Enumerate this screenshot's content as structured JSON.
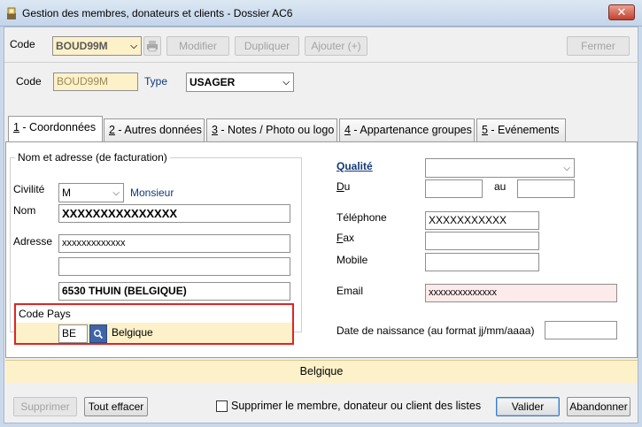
{
  "window": {
    "title": "Gestion des membres, donateurs et clients - Dossier AC6",
    "close_glyph": "✕"
  },
  "toolbar": {
    "code_label": "Code",
    "code_value": "BOUD99M",
    "modifier": "Modifier",
    "dupliquer": "Dupliquer",
    "ajouter": "Ajouter (+)",
    "fermer": "Fermer"
  },
  "header": {
    "code_label": "Code",
    "code_value": "BOUD99M",
    "type_label": "Type",
    "type_value": "USAGER"
  },
  "tabs": [
    {
      "num": "1",
      "label": " - Coordonnées"
    },
    {
      "num": "2",
      "label": " - Autres données"
    },
    {
      "num": "3",
      "label": " - Notes / Photo ou logo"
    },
    {
      "num": "4",
      "label": " - Appartenance groupes"
    },
    {
      "num": "5",
      "label": " - Evénements"
    }
  ],
  "address": {
    "group_title": "Nom et adresse (de facturation)",
    "civilite_label": "Civilité",
    "civilite_value": "M",
    "civilite_text": "Monsieur",
    "nom_label": "Nom",
    "nom_value": "XXXXXXXXXXXXXXX",
    "adresse_label": "Adresse",
    "adresse_line1": "xxxxxxxxxxxxx",
    "adresse_line2": "",
    "adresse_line3": "6530 THUIN (BELGIQUE)",
    "code_pays_label": "Code Pays",
    "code_pays_value": "BE",
    "pays_name": "Belgique"
  },
  "right": {
    "qualite_label": "Qualité",
    "qualite_value": "",
    "du_label_u": "D",
    "du_label_rest": "u",
    "au_label": "au",
    "telephone_label": "Téléphone",
    "telephone_value": "XXXXXXXXXXX",
    "fax_label_u": "F",
    "fax_label_rest": "ax",
    "mobile_label": "Mobile",
    "email_label": "Email",
    "email_value": "xxxxxxxxxxxxxx",
    "dob_label": "Date de naissance (au format jj/mm/aaaa)"
  },
  "status_text": "Belgique",
  "footer": {
    "supprimer": "Supprimer",
    "tout_effacer": "Tout effacer",
    "checkbox_label": "Supprimer le membre, donateur ou client des listes",
    "valider": "Valider",
    "abandonner": "Abandonner"
  },
  "colors": {
    "code_bg": "#fdf1c9",
    "email_bg": "#fdeaea",
    "accent": "#3d7bc7"
  }
}
